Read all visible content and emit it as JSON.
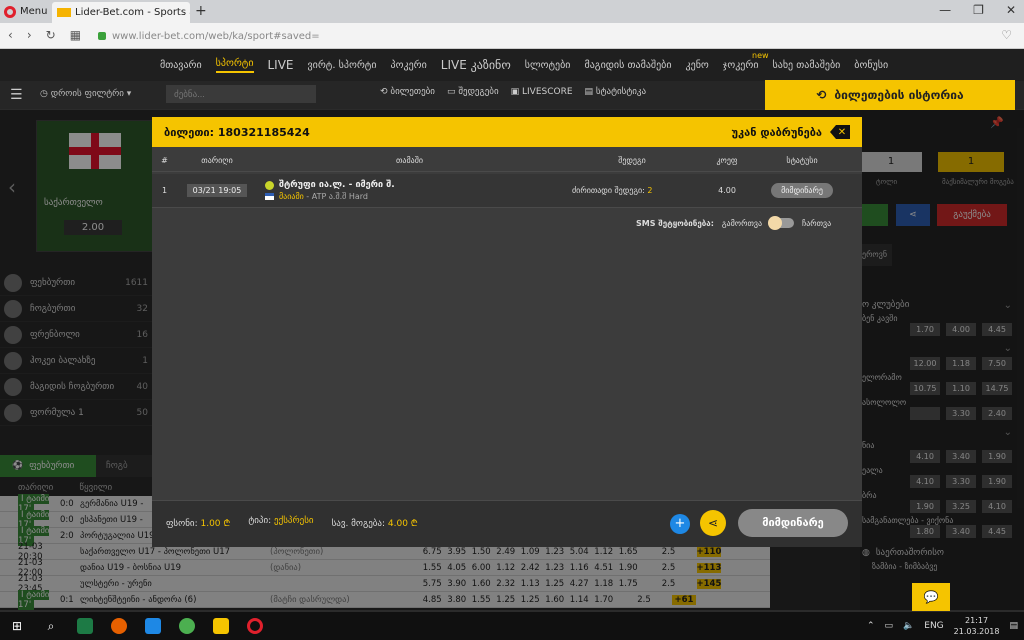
{
  "browser": {
    "menu_label": "Menu",
    "tab_title": "Lider-Bet.com - Sports and",
    "url": "www.lider-bet.com/web/ka/sport#saved="
  },
  "nav": {
    "items": [
      "მთავარი",
      "სპორტი",
      "LIVE",
      "ვირტ. სპორტი",
      "პოკერი",
      "LIVE კაზინო",
      "სლოტები",
      "მაგიდის თამაშები",
      "კენო",
      "ჯოკერი",
      "სახე თამაშები",
      "ბონუსი"
    ],
    "new_badge": "new"
  },
  "subbar": {
    "filter_label": "დროის ფილტრი",
    "search_placeholder": "ძებნა...",
    "tools": [
      "ბილეთები",
      "შედეგები",
      "LIVESCORE",
      "სტატისტიკა"
    ],
    "history_button": "ბილეთების ისტორია"
  },
  "banner": {
    "title": "საქართველო",
    "odd": "2.00"
  },
  "sports": [
    {
      "label": "ფეხბურთი",
      "count": "1611"
    },
    {
      "label": "ჩოგბურთი",
      "count": "32"
    },
    {
      "label": "ფრენბოლი",
      "count": "16"
    },
    {
      "label": "ჰოკეი ბალახზე",
      "count": "1"
    },
    {
      "label": "მაგიდის ჩოგბურთი",
      "count": "40"
    },
    {
      "label": "ფორმულა 1",
      "count": "50"
    }
  ],
  "live_tabs": [
    "ფეხბურთი",
    "ჩოგბ"
  ],
  "match_headers": [
    "თარიღი",
    "წყვილი"
  ],
  "matches": [
    {
      "time": "I ტაიმი 17'",
      "score": "0:0",
      "name": "გერმანია U19 - ",
      "comment": "",
      "odds": [],
      "total": "",
      "more": ""
    },
    {
      "time": "I ტაიმი 17'",
      "score": "0:0",
      "name": "ესპანეთი U19 - ",
      "comment": "",
      "odds": [],
      "total": "",
      "more": ""
    },
    {
      "time": "I ტაიმი 17'",
      "score": "2:0",
      "name": "პორტუგალია U19",
      "comment": "",
      "odds": [],
      "total": "",
      "more": ""
    },
    {
      "time": "21-03 20:30",
      "score": "",
      "name": "საქართველო U17 - პოლონეთი U17",
      "comment": "(პოლონეთი)",
      "odds": [
        "6.75",
        "3.95",
        "1.50",
        "2.49",
        "1.09",
        "1.23",
        "5.04",
        "1.12",
        "1.65"
      ],
      "total": "2.5",
      "more": "+110"
    },
    {
      "time": "21-03 22:00",
      "score": "",
      "name": "დანია U19 - ბოსნია U19",
      "comment": "(დანია)",
      "odds": [
        "1.55",
        "4.05",
        "6.00",
        "1.12",
        "2.42",
        "1.23",
        "1.16",
        "4.51",
        "1.90"
      ],
      "total": "2.5",
      "more": "+113"
    },
    {
      "time": "21-03 23:45",
      "score": "",
      "name": "ულსტერი - ურენი",
      "comment": "",
      "odds": [
        "5.75",
        "3.90",
        "1.60",
        "2.32",
        "1.13",
        "1.25",
        "4.27",
        "1.18",
        "1.75"
      ],
      "total": "2.5",
      "more": "+145"
    },
    {
      "time": "I ტაიმი 17'",
      "score": "0:1",
      "name": "ლიხტენშტეინი - ანდორა (6)",
      "comment": "(მატჩი დასრულდა)",
      "odds": [
        "4.85",
        "3.80",
        "1.55",
        "1.25",
        "1.25",
        "1.60",
        "1.14",
        "1.70"
      ],
      "total": "2.5",
      "more": "+61"
    }
  ],
  "right_col": {
    "box1": "1",
    "box2": "1",
    "label1": "ტოლი",
    "label2": "მაქსიმალური მოგება",
    "red_button": "გაუქმება",
    "tab": "ეროვნ",
    "sections": [
      {
        "title": "ო კლუბები",
        "rows": [
          {
            "name": "ბენ კავში",
            "odds": [
              "1.70",
              "4.00",
              "4.45"
            ]
          }
        ]
      },
      {
        "title": "",
        "rows": [
          {
            "name": "",
            "odds": [
              "12.00",
              "1.18",
              "7.50"
            ]
          },
          {
            "name": "ელორამო",
            "odds": [
              "10.75",
              "1.10",
              "14.75"
            ]
          },
          {
            "name": "ასოლოლო",
            "odds": [
              "",
              "3.30",
              "2.40"
            ]
          }
        ]
      },
      {
        "title": "",
        "rows": [
          {
            "name": "ნია",
            "odds": [
              "4.10",
              "3.40",
              "1.90"
            ]
          },
          {
            "name": "ეალა",
            "odds": [
              "4.10",
              "3.30",
              "1.90"
            ]
          },
          {
            "name": "ბრა",
            "odds": [
              "1.90",
              "3.25",
              "4.10"
            ]
          },
          {
            "name": "სამგანათლება - ვიქონა",
            "odds": [
              "1.80",
              "3.40",
              "4.45"
            ]
          }
        ]
      }
    ],
    "section_bottom": "საერთაშორისო",
    "bottom_row": "ზამბია - ზიმბაბვე"
  },
  "ticket": {
    "title_prefix": "ბილეთი:",
    "ticket_id": "180321185424",
    "back_label": "უკან დაბრუნება",
    "headers": {
      "num": "#",
      "date": "თარიღი",
      "event": "თამაში",
      "outcome": "შედეგი",
      "odd": "კოეფ",
      "status": "სტატუსი"
    },
    "row": {
      "num": "1",
      "date": "03/21 19:05",
      "event": "შტრუფი ია.ლ. - იმერი შ.",
      "competition": "მაიამი",
      "competition_rest": " - ATP ა.შ.შ Hard",
      "outcome_label": "ძირითადი შედეგი:",
      "outcome_value": "2",
      "odd": "4.00",
      "status": "მიმდინარე"
    },
    "sms_label": "SMS შეტყობინება:",
    "sms_off": "გამორთვა",
    "sms_on": "ჩართვა",
    "footer": {
      "stake_label": "ფსონი:",
      "stake": "1.00 ₾",
      "type_label": "ტიპი:",
      "type": "ექსპრესი",
      "win_label": "სავ. მოგება:",
      "win": "4.00 ₾"
    },
    "pending_button": "მიმდინარე"
  },
  "taskbar": {
    "lang": "ENG",
    "time": "21:17",
    "date": "21.03.2018"
  },
  "colors": {
    "accent": "#f5c400",
    "live_green": "#3a8c3a",
    "dark_bg": "#2b2b2b"
  }
}
